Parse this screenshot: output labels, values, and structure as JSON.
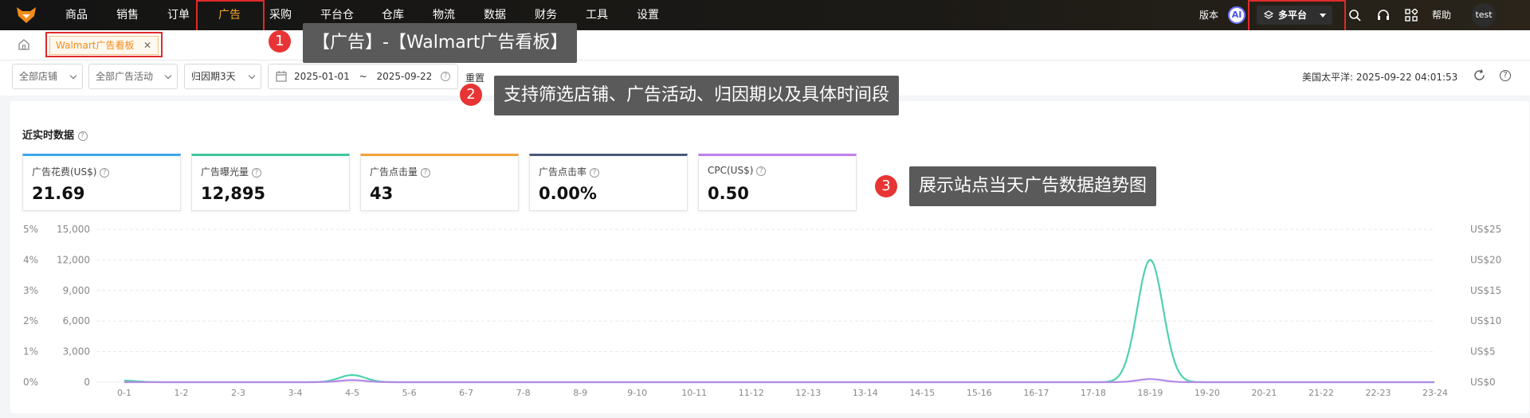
{
  "nav": {
    "items": [
      "商品",
      "销售",
      "订单",
      "广告",
      "采购",
      "平台仓",
      "仓库",
      "物流",
      "数据",
      "财务",
      "工具",
      "设置"
    ],
    "active": "广告",
    "version_label": "版本",
    "ai_label": "AI",
    "platform_label": "多平台",
    "help_label": "帮助",
    "user": "test"
  },
  "tabs": {
    "active_tab": "Walmart广告看板"
  },
  "filters": {
    "store": "全部店铺",
    "campaign": "全部广告活动",
    "attribution": "归因期3天",
    "date_start": "2025-01-01",
    "date_sep": "~",
    "date_end": "2025-09-22",
    "reset": "重置",
    "timezone_time": "美国太平洋: 2025-09-22 04:01:53"
  },
  "callouts": [
    {
      "num": "1",
      "text": "【广告】-【Walmart广告看板】"
    },
    {
      "num": "2",
      "text": "支持筛选店铺、广告活动、归因期以及具体时间段"
    },
    {
      "num": "3",
      "text": "展示站点当天广告数据趋势图"
    }
  ],
  "realtime": {
    "title": "近实时数据",
    "metrics": [
      {
        "label": "广告花费(US$)",
        "value": "21.69",
        "color": "#3ea6f0"
      },
      {
        "label": "广告曝光量",
        "value": "12,895",
        "color": "#3ec99a"
      },
      {
        "label": "广告点击量",
        "value": "43",
        "color": "#f5a13a"
      },
      {
        "label": "广告点击率",
        "value": "0.00%",
        "color": "#4a5a7a"
      },
      {
        "label": "CPC(US$)",
        "value": "0.50",
        "color": "#c07ef0"
      }
    ]
  },
  "chart_data": {
    "type": "line",
    "categories": [
      "0-1",
      "1-2",
      "2-3",
      "3-4",
      "4-5",
      "5-6",
      "6-7",
      "7-8",
      "8-9",
      "9-10",
      "10-11",
      "11-12",
      "12-13",
      "13-14",
      "14-15",
      "15-16",
      "16-17",
      "17-18",
      "18-19",
      "19-20",
      "20-21",
      "21-22",
      "22-23",
      "23-24"
    ],
    "y_left_pct_ticks": [
      "5%",
      "4%",
      "3%",
      "2%",
      "1%",
      "0%"
    ],
    "y_left_count_ticks": [
      "15,000",
      "12,000",
      "9,000",
      "6,000",
      "3,000",
      "0"
    ],
    "y_right_ticks": [
      "US$25",
      "US$20",
      "US$15",
      "US$10",
      "US$5",
      "US$0"
    ],
    "ylim_count": [
      0,
      15000
    ],
    "grid": true,
    "series": [
      {
        "values": [
          150,
          0,
          0,
          0,
          700,
          0,
          0,
          0,
          0,
          0,
          0,
          0,
          0,
          0,
          0,
          0,
          0,
          0,
          12000,
          0,
          0,
          0,
          0,
          0
        ],
        "color": "#4fd1b0"
      },
      {
        "values": [
          0,
          0,
          0,
          0,
          200,
          0,
          0,
          0,
          0,
          0,
          0,
          0,
          0,
          0,
          0,
          0,
          0,
          0,
          300,
          0,
          0,
          0,
          0,
          0
        ],
        "color": "#b58ae6"
      }
    ]
  }
}
